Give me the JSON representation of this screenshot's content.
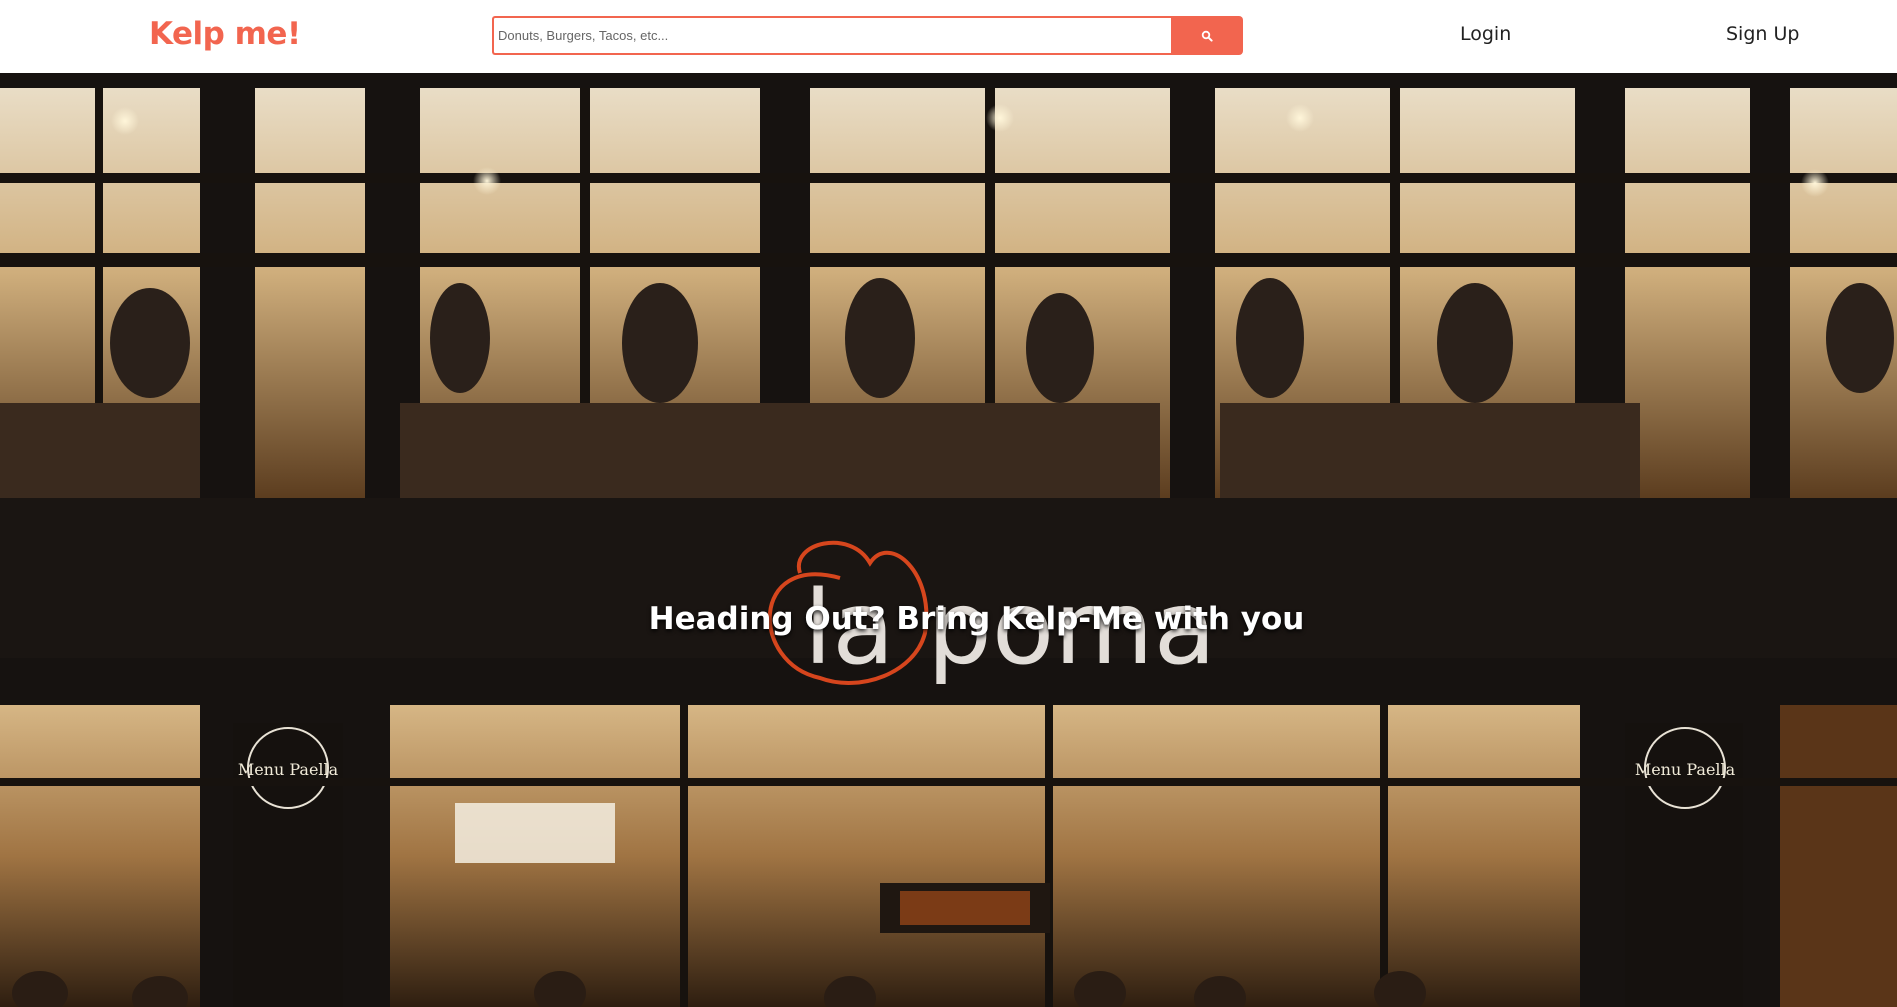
{
  "colors": {
    "brand": "#f2654f",
    "header_bg": "#ffffff",
    "hero_text": "#ffffff"
  },
  "header": {
    "logo": "Kelp me!",
    "search": {
      "placeholder": "Donuts, Burgers, Tacos, etc...",
      "value": "",
      "button_icon": "search-icon"
    },
    "nav": {
      "login": "Login",
      "signup": "Sign Up"
    }
  },
  "hero": {
    "heading": "Heading Out? Bring Kelp-Me with you",
    "image_sign_text": "la poma",
    "image_menu_text": "Menu Paella"
  }
}
